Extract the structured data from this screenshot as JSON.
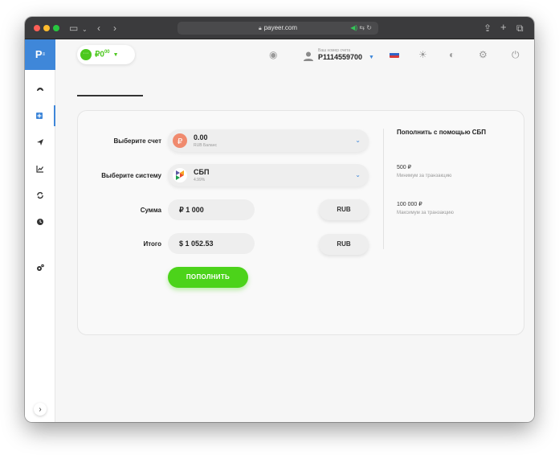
{
  "browser": {
    "url": "payeer.com"
  },
  "sidebar": {
    "logo": "P",
    "logo_sub": "≡",
    "items": [
      {
        "name": "dashboard"
      },
      {
        "name": "deposit"
      },
      {
        "name": "send"
      },
      {
        "name": "trade"
      },
      {
        "name": "exchange"
      },
      {
        "name": "history"
      },
      {
        "name": "settings"
      }
    ]
  },
  "header": {
    "balance": "₽0",
    "balance_decimals": "00",
    "account_label": "Ваш номер счета",
    "account_number": "P1114559700"
  },
  "form": {
    "account_label": "Выберите счет",
    "account_value": "0.00",
    "account_sub": "RUB Баланс",
    "system_label": "Выберите систему",
    "system_value": "СБП",
    "system_sub": "4.99%",
    "amount_label": "Сумма",
    "amount_value": "₽ 1 000",
    "amount_currency": "RUB",
    "total_label": "Итого",
    "total_value": "$ 1 052.53",
    "total_currency": "RUB",
    "submit_label": "пополнить"
  },
  "info": {
    "title": "Пополнить с помощью СБП",
    "min_value": "500 ₽",
    "min_label": "Минимум за транзакцию",
    "max_value": "100 000 ₽",
    "max_label": "Максимум за транзакцию"
  },
  "colors": {
    "accent": "#3f87d9",
    "green": "#4cd31a"
  }
}
